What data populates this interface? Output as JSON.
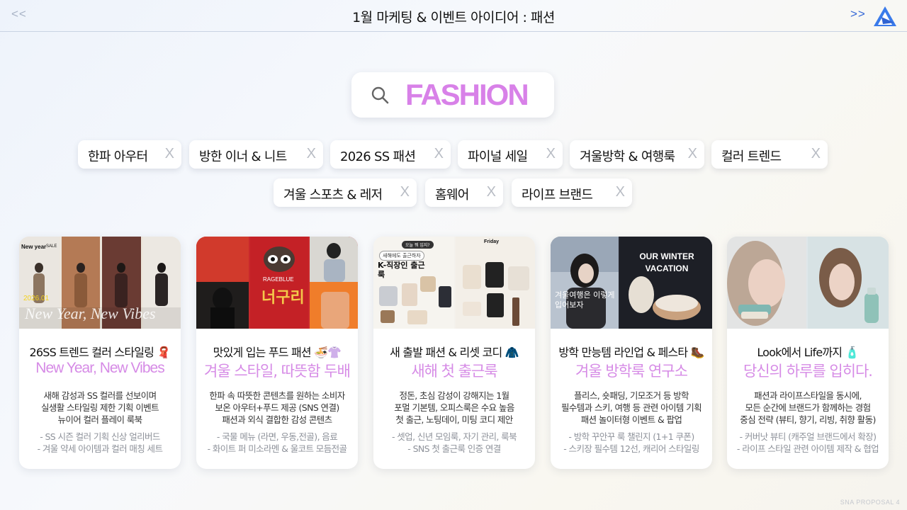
{
  "header": {
    "prev": "<<",
    "title": "1월 마케팅 & 이벤트 아이디어 : 패션",
    "next": ">>"
  },
  "search": {
    "query": "FASHION"
  },
  "tags": [
    {
      "label": "한파 아우터",
      "close": "X"
    },
    {
      "label": "방한 이너 & 니트",
      "close": "X"
    },
    {
      "label": "2026 SS 패션",
      "close": "X"
    },
    {
      "label": "파이널 세일",
      "close": "X"
    },
    {
      "label": "겨울방학 & 여행룩",
      "close": "X"
    },
    {
      "label": "컬러 트렌드",
      "close": "X"
    },
    {
      "label": "겨울 스포츠 & 레저",
      "close": "X"
    },
    {
      "label": "홈웨어",
      "close": "X"
    },
    {
      "label": "라이프 브랜드",
      "close": "X"
    }
  ],
  "cards": [
    {
      "heading": "26SS 트렌드 컬러 스타일링 🧣",
      "subheading": "New Year, New Vibes",
      "desc": [
        "새해 감성과 SS 컬러를 선보이며",
        "실생활 스타일링 제한 기획 이벤트",
        "뉴이어 컬러 플레이 룩북"
      ],
      "bullets": [
        "- SS 시즌 컬러 기획 신상 얼리버드",
        "- 겨울 약세 아이템과 컬러 매칭 세트"
      ],
      "image_text": {
        "tag": "New year",
        "sale": "SALE",
        "overlay": "New Year, New Vibes",
        "date": "2026.01"
      }
    },
    {
      "heading": "맛있게 입는 푸드 패션 🍜👚",
      "subheading": "겨울 스타일, 따뜻함 두배",
      "desc": [
        "한파 속 따뜻한 콘텐츠를 원하는 소비자",
        "보온 아우터+푸드 제공 (SNS 연결)",
        "패션과 외식 결합한 감성 콘텐츠"
      ],
      "bullets": [
        "- 국물 메뉴 (라면, 우동,전골), 음료",
        "- 화이트 퍼 미소라멘 & 울코트 모듬전골"
      ],
      "image_text": {
        "brand": "RAGEBLUE",
        "product": "너구리"
      }
    },
    {
      "heading": "새 출발 패션 & 리셋 코디 🧥",
      "subheading": "새해 첫 출근룩",
      "desc": [
        "정돈, 초심 감성이 강해지는 1월",
        "포멀 기본템, 오피스룩은 수요 높음",
        "첫 출근, 노팅데이, 미팅 코디 제안"
      ],
      "bullets": [
        "- 셋업, 신년 모임룩, 자기 관리, 룩북",
        "- SNS 첫 출근룩 인증 연결"
      ],
      "image_text": {
        "bubble": "새해에도 출근하자",
        "title": "K-직장인 출근룩",
        "day": "Friday",
        "chip": "오늘 뭐 입지?"
      }
    },
    {
      "heading": "방학 만능템 라인업 & 페스타 🥾",
      "subheading": "겨울 방학룩 연구소",
      "desc": [
        "플리스, 숏패딩, 기모조거 등 방학",
        "필수템과 스키, 여행 등 관련 아이템 기획",
        "패션 놀이터형 이벤트 & 팝업"
      ],
      "bullets": [
        "- 방학 꾸안꾸 룩 챌린지 (1+1 쿠폰)",
        "- 스키장 필수템 12선, 캐리어 스타일링"
      ],
      "image_text": {
        "overlay": "겨울여행은 이렇게 입어보자",
        "banner": "OUR WINTER VACATION"
      }
    },
    {
      "heading": "Look에서 Life까지 🧴",
      "subheading": "당신의 하루를 입히다.",
      "desc": [
        "패션과 라이프스타일을 동시에,",
        "모든 순간에 브랜드가 함께하는 경험",
        "중심 전략 (뷰티, 향기, 리빙, 취향 활동)"
      ],
      "bullets": [
        "- 커버낫 뷰티 (캐주얼 브랜드에서 확장)",
        "- 라이프 스타일 관련 아이템 제작 & 협업"
      ],
      "image_text": {}
    }
  ],
  "footer": "SNA PROPOSAL  4",
  "colors": {
    "accent": "#d881e8",
    "nav_active": "#3468d6",
    "nav_inactive": "#a9b4c6"
  }
}
